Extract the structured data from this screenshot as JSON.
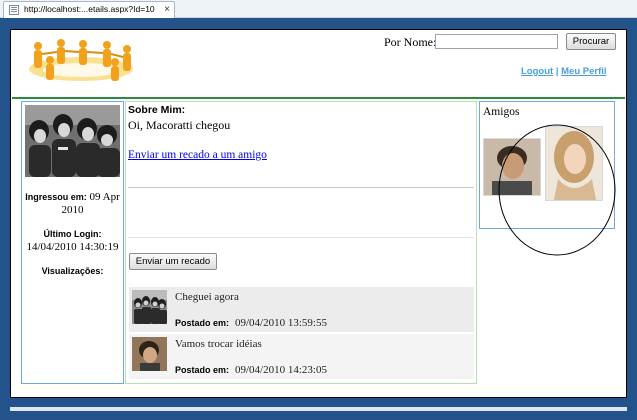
{
  "browser": {
    "tab_title": "http://localhost:...etails.aspx?Id=10",
    "tab_close": "×"
  },
  "header": {
    "search_label": "Por Nome:",
    "search_value": "",
    "search_button": "Procurar",
    "logout_link": "Logout",
    "link_separator": " | ",
    "profile_link": "Meu Perfil"
  },
  "profile": {
    "joined_label": "Ingressou em:",
    "joined_value": "09 Apr 2010",
    "last_login_label": "Último Login:",
    "last_login_value": "14/04/2010 14:30:19",
    "views_label": "Visualizações:"
  },
  "about": {
    "title": "Sobre Mim:",
    "text": "Oi, Macoratti chegou",
    "send_message_link": "Enviar um recado a um amigo",
    "send_button": "Enviar um recado"
  },
  "posts": [
    {
      "text": "Cheguei agora",
      "date_label": "Postado em:",
      "date": "09/04/2010 13:59:55"
    },
    {
      "text": "Vamos trocar idéias",
      "date_label": "Postado em:",
      "date": "09/04/2010 14:23:05"
    }
  ],
  "friends": {
    "title": "Amigos"
  },
  "colors": {
    "frame": "#23538a",
    "header_rule": "#2e8b3c",
    "link_blue": "#4a9fd9",
    "column_border": "#6fa8dc"
  }
}
